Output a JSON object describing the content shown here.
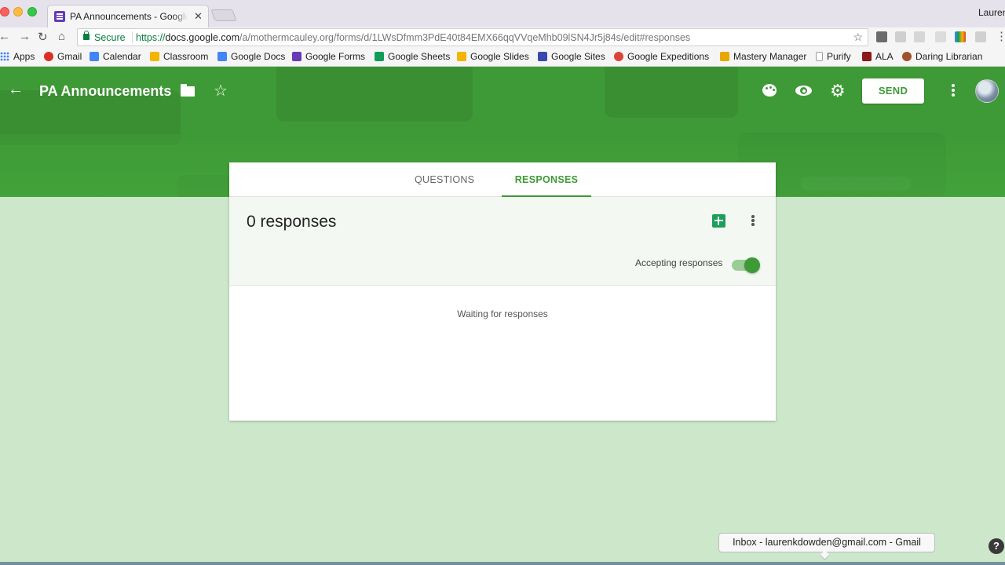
{
  "browser": {
    "tab_title": "PA Announcements - Google Forms",
    "tab_close": "✕",
    "user_name": "Lauren",
    "secure_label": "Secure",
    "url_proto": "https://",
    "url_host": "docs.google.com",
    "url_path": "/a/mothermcauley.org/forms/d/1LWsDfmm3PdE40t84EMX66qqVVqeMhb09lSN4Jr5j84s/edit#responses",
    "bookmarks": [
      {
        "label": "Apps",
        "icon": "apps-icon",
        "color": "#4285f4"
      },
      {
        "label": "Gmail",
        "icon": "gmail-icon",
        "color": "#d93025"
      },
      {
        "label": "Calendar",
        "icon": "calendar-icon",
        "color": "#4285f4"
      },
      {
        "label": "Classroom",
        "icon": "classroom-icon",
        "color": "#f4b400"
      },
      {
        "label": "Google Docs",
        "icon": "docs-icon",
        "color": "#4285f4"
      },
      {
        "label": "Google Forms",
        "icon": "forms-icon",
        "color": "#673ab7"
      },
      {
        "label": "Google Sheets",
        "icon": "sheets-icon",
        "color": "#0f9d58"
      },
      {
        "label": "Google Slides",
        "icon": "slides-icon",
        "color": "#f4b400"
      },
      {
        "label": "Google Sites",
        "icon": "sites-icon",
        "color": "#3949ab"
      },
      {
        "label": "Google Expeditions",
        "icon": "expeditions-icon",
        "color": "#db4437"
      },
      {
        "label": "Mastery Manager",
        "icon": "mastery-manager-icon",
        "color": "#e6a700"
      },
      {
        "label": "Purify",
        "icon": "page-icon",
        "color": "#9e9e9e"
      },
      {
        "label": "ALA",
        "icon": "ala-icon",
        "color": "#8b1a1a"
      },
      {
        "label": "Daring Librarian",
        "icon": "daring-librarian-icon",
        "color": "#a0522d"
      }
    ]
  },
  "header": {
    "form_title": "PA Announcements",
    "send_label": "SEND",
    "accent_color": "#3e9a36"
  },
  "tabs": {
    "questions": "QUESTIONS",
    "responses": "RESPONSES",
    "active": "responses"
  },
  "summary": {
    "response_count": "0 responses",
    "accepting_label": "Accepting responses",
    "accepting_on": true
  },
  "body": {
    "waiting_text": "Waiting for responses"
  },
  "tooltip": {
    "text": "Inbox - laurenkdowden@gmail.com - Gmail"
  },
  "help": {
    "glyph": "?"
  }
}
